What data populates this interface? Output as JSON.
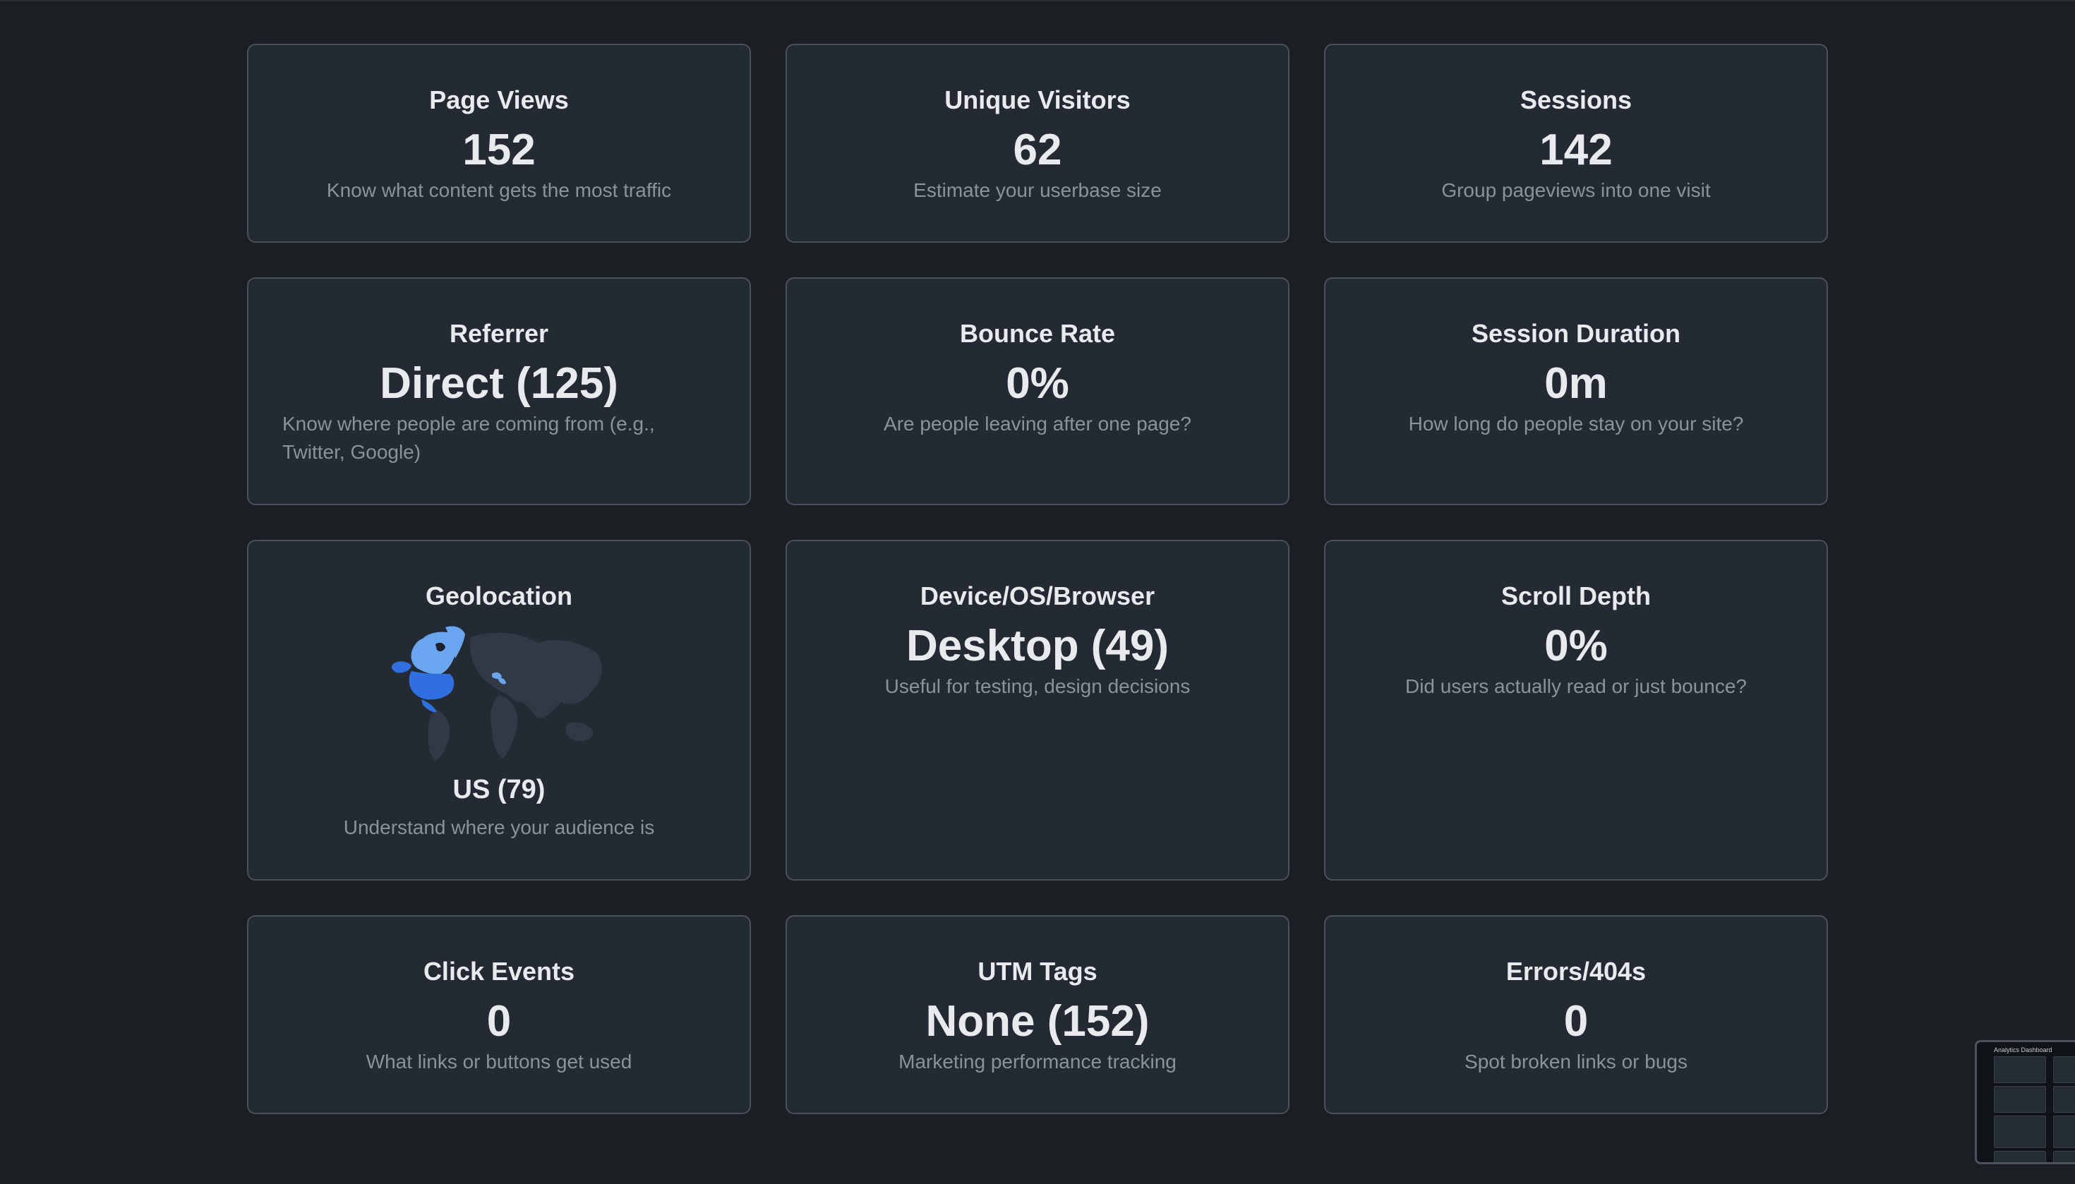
{
  "cards": [
    {
      "title": "Page Views",
      "value": "152",
      "desc": "Know what content gets the most traffic"
    },
    {
      "title": "Unique Visitors",
      "value": "62",
      "desc": "Estimate your userbase size"
    },
    {
      "title": "Sessions",
      "value": "142",
      "desc": "Group pageviews into one visit"
    },
    {
      "title": "Referrer",
      "value": "Direct (125)",
      "desc": "Know where people are coming from (e.g., Twitter, Google)"
    },
    {
      "title": "Bounce Rate",
      "value": "0%",
      "desc": "Are people leaving after one page?"
    },
    {
      "title": "Session Duration",
      "value": "0m",
      "desc": "How long do people stay on your site?"
    },
    {
      "title": "Geolocation",
      "value": "US (79)",
      "desc": "Understand where your audience is"
    },
    {
      "title": "Device/OS/Browser",
      "value": "Desktop (49)",
      "desc": "Useful for testing, design decisions"
    },
    {
      "title": "Scroll Depth",
      "value": "0%",
      "desc": "Did users actually read or just bounce?"
    },
    {
      "title": "Click Events",
      "value": "0",
      "desc": "What links or buttons get used"
    },
    {
      "title": "UTM Tags",
      "value": "None (152)",
      "desc": "Marketing performance tracking"
    },
    {
      "title": "Errors/404s",
      "value": "0",
      "desc": "Spot broken links or bugs"
    }
  ],
  "thumbnail": {
    "title": "Analytics Dashboard"
  },
  "colors": {
    "background": "#1b1f24",
    "card": "#242a33",
    "card_border": "#4a515b",
    "text_primary": "#e8eaed",
    "text_muted": "#8b929c",
    "map_highlight": "#2f6fe0",
    "map_light": "#6aa6f0",
    "map_base": "#323945"
  }
}
